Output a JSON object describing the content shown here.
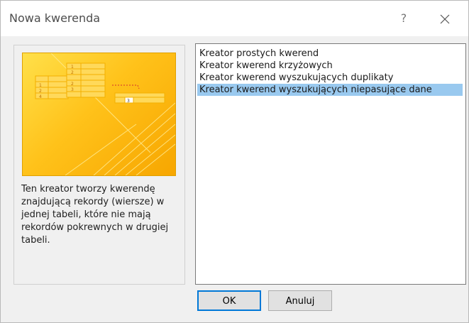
{
  "window": {
    "title": "Nowa kwerenda",
    "help_label": "?",
    "close_icon": "close-icon"
  },
  "preview": {
    "icon": "query-wizard-illustration",
    "table_numbers": [
      "1",
      "2",
      "3",
      "4"
    ],
    "result_number": "3"
  },
  "description": "Ten kreator tworzy kwerendę znajdującą rekordy (wiersze) w jednej tabeli, które nie mają rekordów pokrewnych w drugiej tabeli.",
  "list": {
    "items": [
      {
        "label": "Kreator prostych kwerend"
      },
      {
        "label": "Kreator kwerend krzyżowych"
      },
      {
        "label": "Kreator kwerend wyszukujących duplikaty"
      },
      {
        "label": "Kreator kwerend wyszukujących niepasujące dane"
      }
    ],
    "selected_index": 3
  },
  "buttons": {
    "ok": "OK",
    "cancel": "Anuluj"
  },
  "colors": {
    "selection": "#99c9ef",
    "preview_bg": "#ffc21a"
  }
}
